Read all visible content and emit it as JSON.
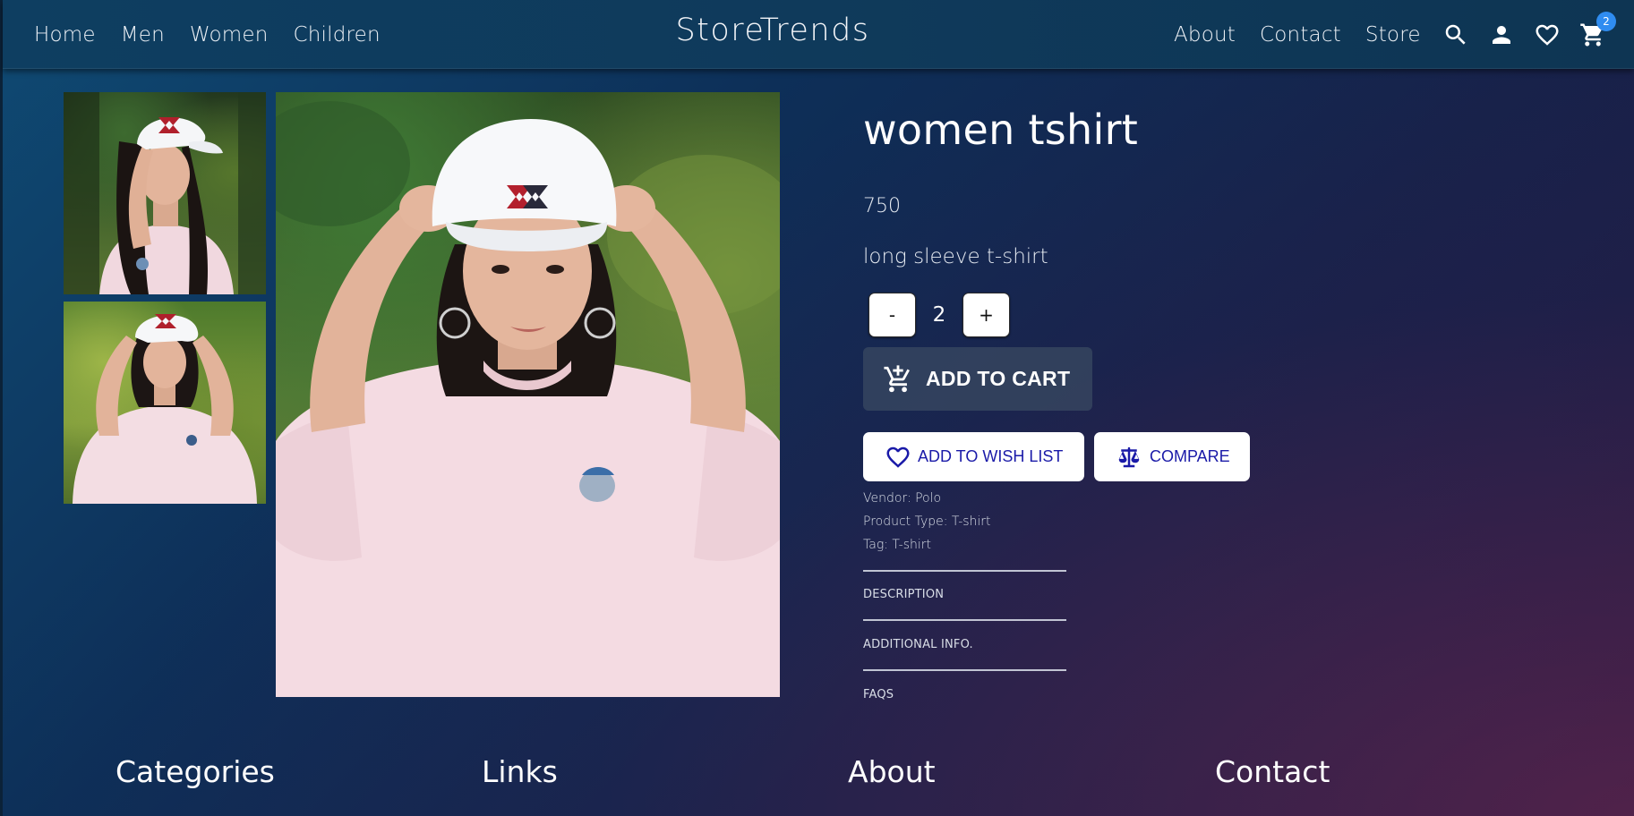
{
  "nav": {
    "left": [
      "Home",
      "Men",
      "Women",
      "Children"
    ],
    "brand": "StoreTrends",
    "right": [
      "About",
      "Contact",
      "Store"
    ],
    "icons": [
      "search-icon",
      "user-icon",
      "heart-icon",
      "cart-icon"
    ],
    "cart_badge": "2"
  },
  "product": {
    "title": "women tshirt",
    "price": "750",
    "subtitle": "long sleeve t-shirt",
    "quantity": "2",
    "minus_label": "-",
    "plus_label": "+",
    "add_to_cart": "ADD TO CART",
    "add_to_wishlist": "ADD TO WISH LIST",
    "compare": "COMPARE",
    "vendor": "Vendor: Polo",
    "product_type": "Product Type: T-shirt",
    "tag": "Tag: T-shirt",
    "accordion": [
      "DESCRIPTION",
      "ADDITIONAL INFO.",
      "FAQS"
    ]
  },
  "footer": {
    "headings": [
      "Categories",
      "Links",
      "About",
      "Contact"
    ]
  },
  "colors": {
    "header": "#0f3a5b",
    "badge": "#2f8cf0",
    "action_text": "#1a1aa8"
  }
}
